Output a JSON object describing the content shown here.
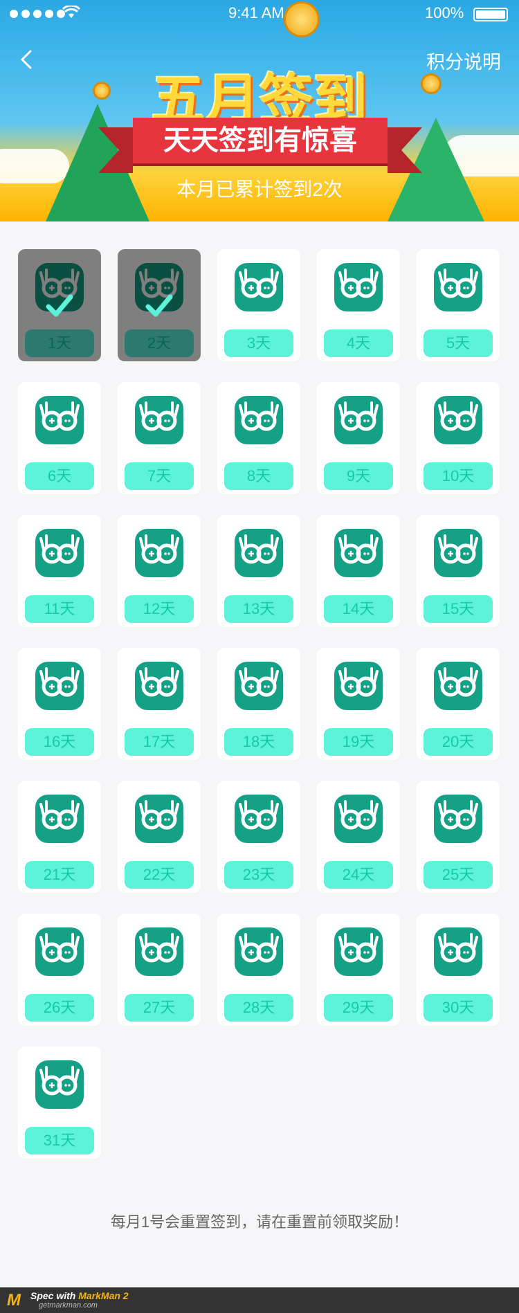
{
  "status": {
    "time": "9:41 AM",
    "battery": "100%"
  },
  "nav": {
    "back_icon": "chevron-left-icon",
    "rules_label": "积分说明"
  },
  "banner": {
    "title": "五月签到",
    "subtitle": "天天签到有惊喜",
    "summary": "本月已累计签到2次"
  },
  "days": [
    {
      "label": "1天",
      "checked": true
    },
    {
      "label": "2天",
      "checked": true
    },
    {
      "label": "3天",
      "checked": false
    },
    {
      "label": "4天",
      "checked": false
    },
    {
      "label": "5天",
      "checked": false
    },
    {
      "label": "6天",
      "checked": false
    },
    {
      "label": "7天",
      "checked": false
    },
    {
      "label": "8天",
      "checked": false
    },
    {
      "label": "9天",
      "checked": false
    },
    {
      "label": "10天",
      "checked": false
    },
    {
      "label": "11天",
      "checked": false
    },
    {
      "label": "12天",
      "checked": false
    },
    {
      "label": "13天",
      "checked": false
    },
    {
      "label": "14天",
      "checked": false
    },
    {
      "label": "15天",
      "checked": false
    },
    {
      "label": "16天",
      "checked": false
    },
    {
      "label": "17天",
      "checked": false
    },
    {
      "label": "18天",
      "checked": false
    },
    {
      "label": "19天",
      "checked": false
    },
    {
      "label": "20天",
      "checked": false
    },
    {
      "label": "21天",
      "checked": false
    },
    {
      "label": "22天",
      "checked": false
    },
    {
      "label": "23天",
      "checked": false
    },
    {
      "label": "24天",
      "checked": false
    },
    {
      "label": "25天",
      "checked": false
    },
    {
      "label": "26天",
      "checked": false
    },
    {
      "label": "27天",
      "checked": false
    },
    {
      "label": "28天",
      "checked": false
    },
    {
      "label": "29天",
      "checked": false
    },
    {
      "label": "30天",
      "checked": false
    },
    {
      "label": "31天",
      "checked": false
    }
  ],
  "day_icon": "game-glasses-icon",
  "note": "每月1号会重置签到，请在重置前领取奖励！",
  "footer": {
    "brand_prefix": "Spec with ",
    "brand": "MarkMan 2",
    "site": "getmarkman.com"
  },
  "colors": {
    "page_bg": "#f6f6f9",
    "card_bg": "#ffffff",
    "day_bg": "#5df3da",
    "day_text": "#13cbac",
    "icon": "#13a085",
    "note_text": "#666666"
  }
}
